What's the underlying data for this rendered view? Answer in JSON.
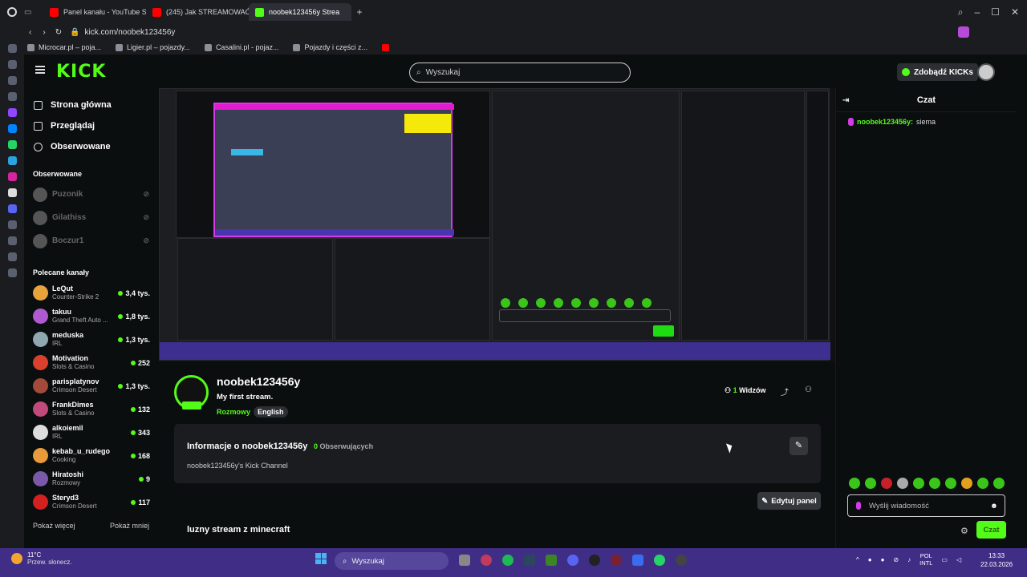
{
  "browser": {
    "tabs": [
      {
        "label": "Panel kanału - YouTube St",
        "color": "#ff0000"
      },
      {
        "label": "(245) Jak STREAMOWAĆ",
        "color": "#ff0000"
      },
      {
        "label": "noobek123456y Strea",
        "color": "#53fc18",
        "active": true
      }
    ],
    "url": "kick.com/noobek123456y",
    "bookmarks": [
      "Microcar.pl – poja...",
      "Ligier.pl – pojazdy...",
      "Casalini.pl - pojaz...",
      "Pojazdy i części z..."
    ]
  },
  "header": {
    "logo": "KICK",
    "search_placeholder": "Wyszukaj",
    "kicks_button": "Zdobądź KICKs"
  },
  "nav": {
    "main": [
      "Strona główna",
      "Przeglądaj",
      "Obserwowane"
    ],
    "followed_title": "Obserwowane",
    "followed": [
      "Puzonik",
      "Gilathiss",
      "Boczur1"
    ],
    "recommended_title": "Polecane kanały",
    "recommended": [
      {
        "name": "LeQut",
        "category": "Counter-Strike 2",
        "viewers": "3,4 tys.",
        "color": "#e8a33a"
      },
      {
        "name": "takuu",
        "category": "Grand Theft Auto ...",
        "viewers": "1,8 tys.",
        "color": "#b05ad0"
      },
      {
        "name": "meduska",
        "category": "IRL",
        "viewers": "1,3 tys.",
        "color": "#8fa8b0"
      },
      {
        "name": "Motivation",
        "category": "Slots & Casino",
        "viewers": "252",
        "color": "#d9412e"
      },
      {
        "name": "parisplatynov",
        "category": "Crimson Desert",
        "viewers": "1,3 tys.",
        "color": "#a44a3a"
      },
      {
        "name": "FrankDimes",
        "category": "Slots & Casino",
        "viewers": "132",
        "color": "#c04a7a"
      },
      {
        "name": "alkoiemil",
        "category": "IRL",
        "viewers": "343",
        "color": "#ddd"
      },
      {
        "name": "kebab_u_rudego",
        "category": "Cooking",
        "viewers": "168",
        "color": "#e99a3a"
      },
      {
        "name": "Hiratoshi",
        "category": "Rozmowy",
        "viewers": "9",
        "color": "#7a5aa8"
      },
      {
        "name": "Steryd3",
        "category": "Crimson Desert",
        "viewers": "117",
        "color": "#d42020"
      }
    ],
    "show_more": "Pokaż więcej",
    "show_less": "Pokaż mniej"
  },
  "stream": {
    "channel": "noobek123456y",
    "title": "My first stream.",
    "category": "Rozmowy",
    "language": "English",
    "viewers_count": "1",
    "viewers_label": "Widzów",
    "live_badge": "LIVE"
  },
  "about": {
    "title": "Informacje o noobek123456y",
    "followers_count": "0",
    "followers_label": "Obserwujących",
    "description": "noobek123456y's Kick Channel",
    "edit_panel": "Edytuj panel",
    "panel_title": "luzny stream z minecraft"
  },
  "chat": {
    "title": "Czat",
    "messages": [
      {
        "user": "noobek123456y",
        "text": "siema"
      }
    ],
    "input_placeholder": "Wyślij wiadomość",
    "send_label": "Czat"
  },
  "taskbar": {
    "temp": "11°C",
    "weather": "Przew. słonecz.",
    "search": "Wyszukaj",
    "lang1": "POL",
    "lang2": "INTL",
    "time": "13:33",
    "date": "22.03.2026"
  }
}
